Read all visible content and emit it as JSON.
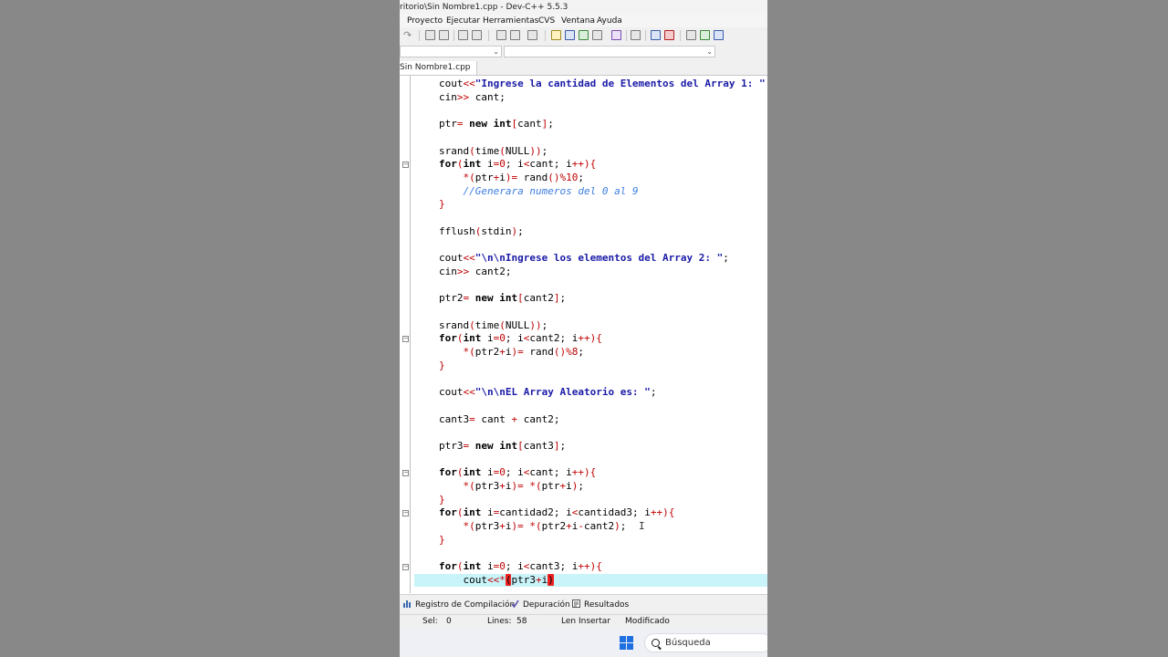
{
  "window": {
    "title": "ritorio\\Sin Nombre1.cpp - Dev-C++ 5.5.3"
  },
  "menu": {
    "items": [
      "Proyecto",
      "Ejecutar",
      "Herramientas",
      "CVS",
      "Ventana",
      "Ayuda"
    ]
  },
  "tab": {
    "label": "Sin Nombre1.cpp"
  },
  "code": {
    "lines": [
      [
        [
          "p",
          "cout"
        ],
        [
          "o",
          "<<"
        ],
        [
          "s",
          "\"Ingrese la cantidad de Elementos del Array 1: \""
        ]
      ],
      [
        [
          "p",
          "cin"
        ],
        [
          "o",
          ">>"
        ],
        [
          "p",
          " cant;"
        ]
      ],
      [],
      [
        [
          "p",
          "ptr"
        ],
        [
          "o",
          "="
        ],
        [
          "p",
          " "
        ],
        [
          "k",
          "new int"
        ],
        [
          "o",
          "["
        ],
        [
          "p",
          "cant"
        ],
        [
          "o",
          "]"
        ],
        [
          "p",
          ";"
        ]
      ],
      [],
      [
        [
          "p",
          "srand"
        ],
        [
          "o",
          "("
        ],
        [
          "p",
          "time"
        ],
        [
          "o",
          "("
        ],
        [
          "p",
          "NULL"
        ],
        [
          "o",
          "))"
        ],
        [
          "p",
          ";"
        ]
      ],
      [
        [
          "k",
          "for"
        ],
        [
          "o",
          "("
        ],
        [
          "k",
          "int"
        ],
        [
          "p",
          " i"
        ],
        [
          "o",
          "="
        ],
        [
          "n",
          "0"
        ],
        [
          "p",
          "; i"
        ],
        [
          "o",
          "<"
        ],
        [
          "p",
          "cant; i"
        ],
        [
          "o",
          "++){"
        ]
      ],
      [
        [
          "p",
          "    "
        ],
        [
          "o",
          "*("
        ],
        [
          "p",
          "ptr"
        ],
        [
          "o",
          "+"
        ],
        [
          "p",
          "i"
        ],
        [
          "o",
          ")="
        ],
        [
          "p",
          " rand"
        ],
        [
          "o",
          "()%"
        ],
        [
          "n",
          "10"
        ],
        [
          "p",
          ";"
        ]
      ],
      [
        [
          "p",
          "    "
        ],
        [
          "c",
          "//Generara numeros del 0 al 9"
        ]
      ],
      [
        [
          "o",
          "}"
        ]
      ],
      [],
      [
        [
          "p",
          "fflush"
        ],
        [
          "o",
          "("
        ],
        [
          "p",
          "stdin"
        ],
        [
          "o",
          ")"
        ],
        [
          "p",
          ";"
        ]
      ],
      [],
      [
        [
          "p",
          "cout"
        ],
        [
          "o",
          "<<"
        ],
        [
          "s",
          "\"\\n\\nIngrese los elementos del Array 2: \""
        ],
        [
          "p",
          ";"
        ]
      ],
      [
        [
          "p",
          "cin"
        ],
        [
          "o",
          ">>"
        ],
        [
          "p",
          " cant2;"
        ]
      ],
      [],
      [
        [
          "p",
          "ptr2"
        ],
        [
          "o",
          "="
        ],
        [
          "p",
          " "
        ],
        [
          "k",
          "new int"
        ],
        [
          "o",
          "["
        ],
        [
          "p",
          "cant2"
        ],
        [
          "o",
          "]"
        ],
        [
          "p",
          ";"
        ]
      ],
      [],
      [
        [
          "p",
          "srand"
        ],
        [
          "o",
          "("
        ],
        [
          "p",
          "time"
        ],
        [
          "o",
          "("
        ],
        [
          "p",
          "NULL"
        ],
        [
          "o",
          "))"
        ],
        [
          "p",
          ";"
        ]
      ],
      [
        [
          "k",
          "for"
        ],
        [
          "o",
          "("
        ],
        [
          "k",
          "int"
        ],
        [
          "p",
          " i"
        ],
        [
          "o",
          "="
        ],
        [
          "n",
          "0"
        ],
        [
          "p",
          "; i"
        ],
        [
          "o",
          "<"
        ],
        [
          "p",
          "cant2; i"
        ],
        [
          "o",
          "++){"
        ]
      ],
      [
        [
          "p",
          "    "
        ],
        [
          "o",
          "*("
        ],
        [
          "p",
          "ptr2"
        ],
        [
          "o",
          "+"
        ],
        [
          "p",
          "i"
        ],
        [
          "o",
          ")="
        ],
        [
          "p",
          " rand"
        ],
        [
          "o",
          "()%"
        ],
        [
          "n",
          "8"
        ],
        [
          "p",
          ";"
        ]
      ],
      [
        [
          "o",
          "}"
        ]
      ],
      [],
      [
        [
          "p",
          "cout"
        ],
        [
          "o",
          "<<"
        ],
        [
          "s",
          "\"\\n\\nEL Array Aleatorio es: \""
        ],
        [
          "p",
          ";"
        ]
      ],
      [],
      [
        [
          "p",
          "cant3"
        ],
        [
          "o",
          "="
        ],
        [
          "p",
          " cant "
        ],
        [
          "o",
          "+"
        ],
        [
          "p",
          " cant2;"
        ]
      ],
      [],
      [
        [
          "p",
          "ptr3"
        ],
        [
          "o",
          "="
        ],
        [
          "p",
          " "
        ],
        [
          "k",
          "new int"
        ],
        [
          "o",
          "["
        ],
        [
          "p",
          "cant3"
        ],
        [
          "o",
          "]"
        ],
        [
          "p",
          ";"
        ]
      ],
      [],
      [
        [
          "k",
          "for"
        ],
        [
          "o",
          "("
        ],
        [
          "k",
          "int"
        ],
        [
          "p",
          " i"
        ],
        [
          "o",
          "="
        ],
        [
          "n",
          "0"
        ],
        [
          "p",
          "; i"
        ],
        [
          "o",
          "<"
        ],
        [
          "p",
          "cant; i"
        ],
        [
          "o",
          "++){"
        ]
      ],
      [
        [
          "p",
          "    "
        ],
        [
          "o",
          "*("
        ],
        [
          "p",
          "ptr3"
        ],
        [
          "o",
          "+"
        ],
        [
          "p",
          "i"
        ],
        [
          "o",
          ")="
        ],
        [
          "p",
          " "
        ],
        [
          "o",
          "*("
        ],
        [
          "p",
          "ptr"
        ],
        [
          "o",
          "+"
        ],
        [
          "p",
          "i"
        ],
        [
          "o",
          ")"
        ],
        [
          "p",
          ";"
        ]
      ],
      [
        [
          "o",
          "}"
        ]
      ],
      [
        [
          "k",
          "for"
        ],
        [
          "o",
          "("
        ],
        [
          "k",
          "int"
        ],
        [
          "p",
          " i"
        ],
        [
          "o",
          "="
        ],
        [
          "p",
          "cantidad2; i"
        ],
        [
          "o",
          "<"
        ],
        [
          "p",
          "cantidad3; i"
        ],
        [
          "o",
          "++){"
        ]
      ],
      [
        [
          "p",
          "    "
        ],
        [
          "o",
          "*("
        ],
        [
          "p",
          "ptr3"
        ],
        [
          "o",
          "+"
        ],
        [
          "p",
          "i"
        ],
        [
          "o",
          ")="
        ],
        [
          "p",
          " "
        ],
        [
          "o",
          "*("
        ],
        [
          "p",
          "ptr2"
        ],
        [
          "o",
          "+"
        ],
        [
          "p",
          "i"
        ],
        [
          "o",
          "-"
        ],
        [
          "p",
          "cant2"
        ],
        [
          "o",
          ")"
        ],
        [
          "p",
          ";"
        ]
      ],
      [
        [
          "o",
          "}"
        ]
      ],
      [],
      [
        [
          "k",
          "for"
        ],
        [
          "o",
          "("
        ],
        [
          "k",
          "int"
        ],
        [
          "p",
          " i"
        ],
        [
          "o",
          "="
        ],
        [
          "n",
          "0"
        ],
        [
          "p",
          "; i"
        ],
        [
          "o",
          "<"
        ],
        [
          "p",
          "cant3; i"
        ],
        [
          "o",
          "++){"
        ]
      ],
      [
        [
          "p",
          "    cout"
        ],
        [
          "o",
          "<<"
        ],
        [
          "o",
          "*"
        ],
        [
          "x",
          "("
        ],
        [
          "p",
          "ptr3"
        ],
        [
          "o",
          "+"
        ],
        [
          "p",
          "i"
        ],
        [
          "x",
          ")"
        ]
      ]
    ],
    "highlight_line": 37,
    "fold_lines": [
      6,
      19,
      29,
      32,
      36
    ]
  },
  "bottom_tabs": [
    {
      "label": "Registro de Compilación",
      "icon": "bar-chart-icon"
    },
    {
      "label": "Depuración",
      "icon": "check-icon"
    },
    {
      "label": "Resultados",
      "icon": "results-icon"
    }
  ],
  "status": {
    "sel_label": "Sel:",
    "sel_value": "0",
    "lines_label": "Lines:",
    "lines_value": "58",
    "mode": "Len Insertar",
    "modified": "Modificado"
  },
  "taskbar": {
    "search_placeholder": "Búsqueda"
  },
  "colors": {
    "keyword": "#000000",
    "string": "#1a1aa8",
    "comment": "#3b7de0",
    "operator": "#c00000",
    "current_line": "#c8f4fa"
  }
}
